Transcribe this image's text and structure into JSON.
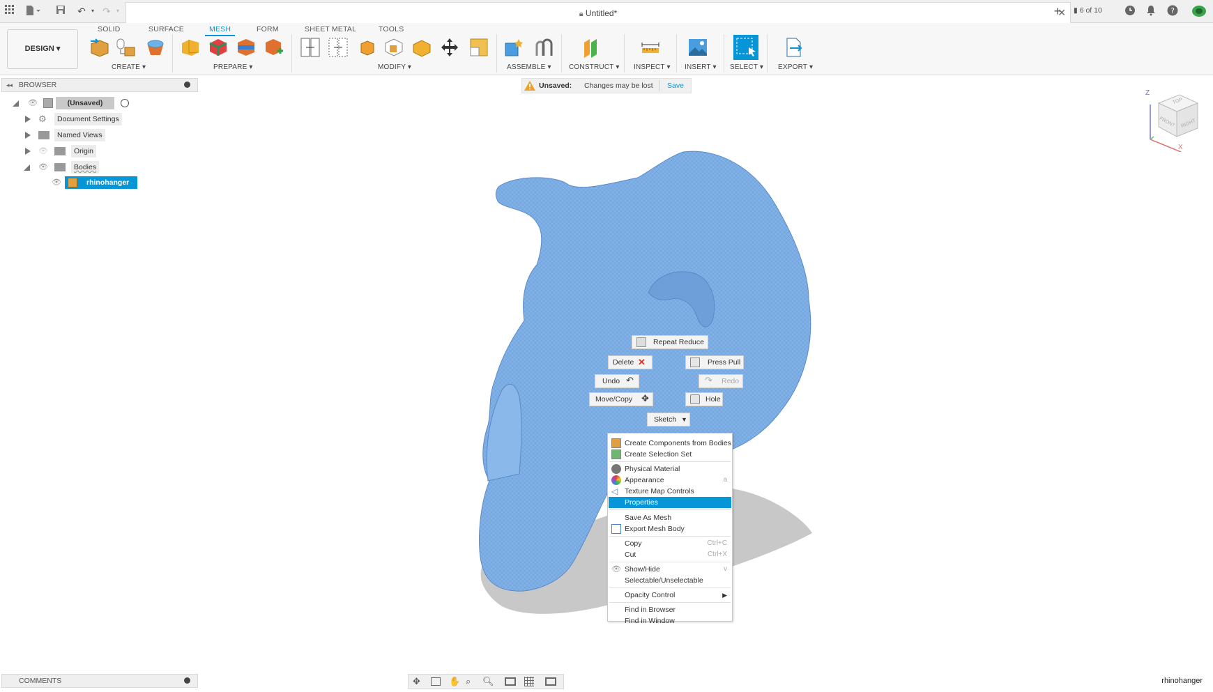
{
  "titlebar": {
    "title": "Untitled*",
    "job_count": "6 of 10"
  },
  "toolbar": {
    "workspace": "DESIGN",
    "tabs": [
      "SOLID",
      "SURFACE",
      "MESH",
      "FORM",
      "SHEET METAL",
      "TOOLS"
    ],
    "active_tab": "MESH",
    "groups": [
      "CREATE",
      "PREPARE",
      "MODIFY",
      "ASSEMBLE",
      "CONSTRUCT",
      "INSPECT",
      "INSERT",
      "SELECT",
      "EXPORT"
    ]
  },
  "browser": {
    "header": "BROWSER",
    "root": "(Unsaved)",
    "items": [
      "Document Settings",
      "Named Views",
      "Origin",
      "Bodies"
    ],
    "body": "rhinohanger"
  },
  "banner": {
    "label": "Unsaved:",
    "message": "Changes may be lost",
    "action": "Save"
  },
  "viewcube": {
    "top": "TOP",
    "front": "FRONT",
    "right": "RIGHT",
    "z": "Z",
    "x": "X"
  },
  "marking_menu": {
    "repeat": "Repeat Reduce",
    "delete": "Delete",
    "press_pull": "Press Pull",
    "undo": "Undo",
    "redo": "Redo",
    "move_copy": "Move/Copy",
    "hole": "Hole",
    "sketch": "Sketch"
  },
  "context_menu": {
    "items": [
      {
        "label": "Create Components from Bodies",
        "shortcut": ""
      },
      {
        "label": "Create Selection Set",
        "shortcut": ""
      },
      {
        "label": "Physical Material",
        "shortcut": ""
      },
      {
        "label": "Appearance",
        "shortcut": "a"
      },
      {
        "label": "Texture Map Controls",
        "shortcut": ""
      },
      {
        "label": "Properties",
        "shortcut": ""
      },
      {
        "label": "Save As Mesh",
        "shortcut": ""
      },
      {
        "label": "Export Mesh Body",
        "shortcut": ""
      },
      {
        "label": "Copy",
        "shortcut": "Ctrl+C"
      },
      {
        "label": "Cut",
        "shortcut": "Ctrl+X"
      },
      {
        "label": "Show/Hide",
        "shortcut": "v"
      },
      {
        "label": "Selectable/Unselectable",
        "shortcut": ""
      },
      {
        "label": "Opacity Control",
        "shortcut": ""
      },
      {
        "label": "Find in Browser",
        "shortcut": ""
      },
      {
        "label": "Find in Window",
        "shortcut": ""
      }
    ],
    "highlighted": "Properties"
  },
  "comments": {
    "label": "COMMENTS"
  },
  "status": {
    "document_name": "rhinohanger"
  },
  "colors": {
    "accent": "#0696d7",
    "mesh": "#7fb0e6",
    "warning": "#f0a020",
    "delete": "#e0302a"
  }
}
